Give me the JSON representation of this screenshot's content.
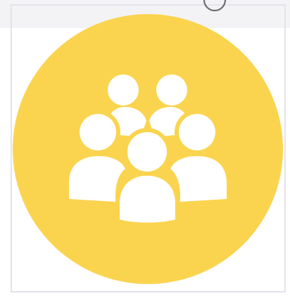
{
  "image": {
    "alt_icon": "group-people-icon",
    "circle_color": "#FBD44F",
    "figure_color": "#FFFFFF"
  },
  "frame": {
    "border_color": "#E3E3EA",
    "handle_icon": "rotate-handle-icon"
  },
  "top_bar": {
    "background": "#F3F3F5"
  }
}
